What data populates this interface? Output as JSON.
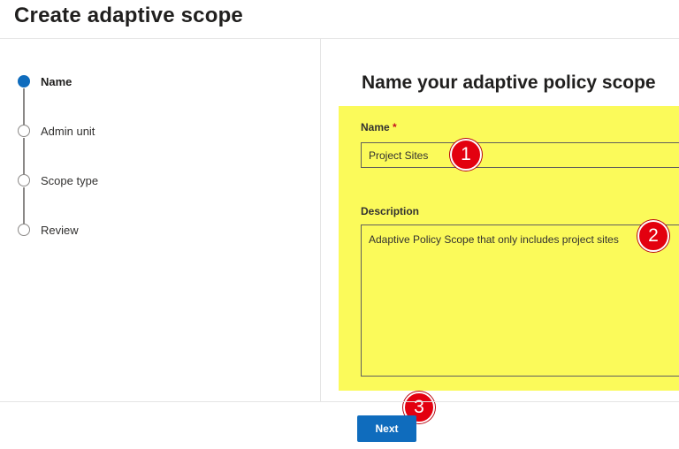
{
  "header": {
    "title": "Create adaptive scope"
  },
  "stepper": {
    "steps": [
      {
        "label": "Name",
        "state": "current"
      },
      {
        "label": "Admin unit",
        "state": "pending"
      },
      {
        "label": "Scope type",
        "state": "pending"
      },
      {
        "label": "Review",
        "state": "pending"
      }
    ]
  },
  "form": {
    "title": "Name your adaptive policy scope",
    "name_label": "Name",
    "required_marker": "*",
    "name_value": "Project Sites",
    "description_label": "Description",
    "description_value": "Adaptive Policy Scope that only includes project sites"
  },
  "callouts": [
    "1",
    "2",
    "3"
  ],
  "footer": {
    "next_label": "Next"
  },
  "colors": {
    "accent": "#0f6cbd",
    "highlight": "#fbfa5a",
    "callout": "#e3000f",
    "required": "#c50f1f"
  }
}
